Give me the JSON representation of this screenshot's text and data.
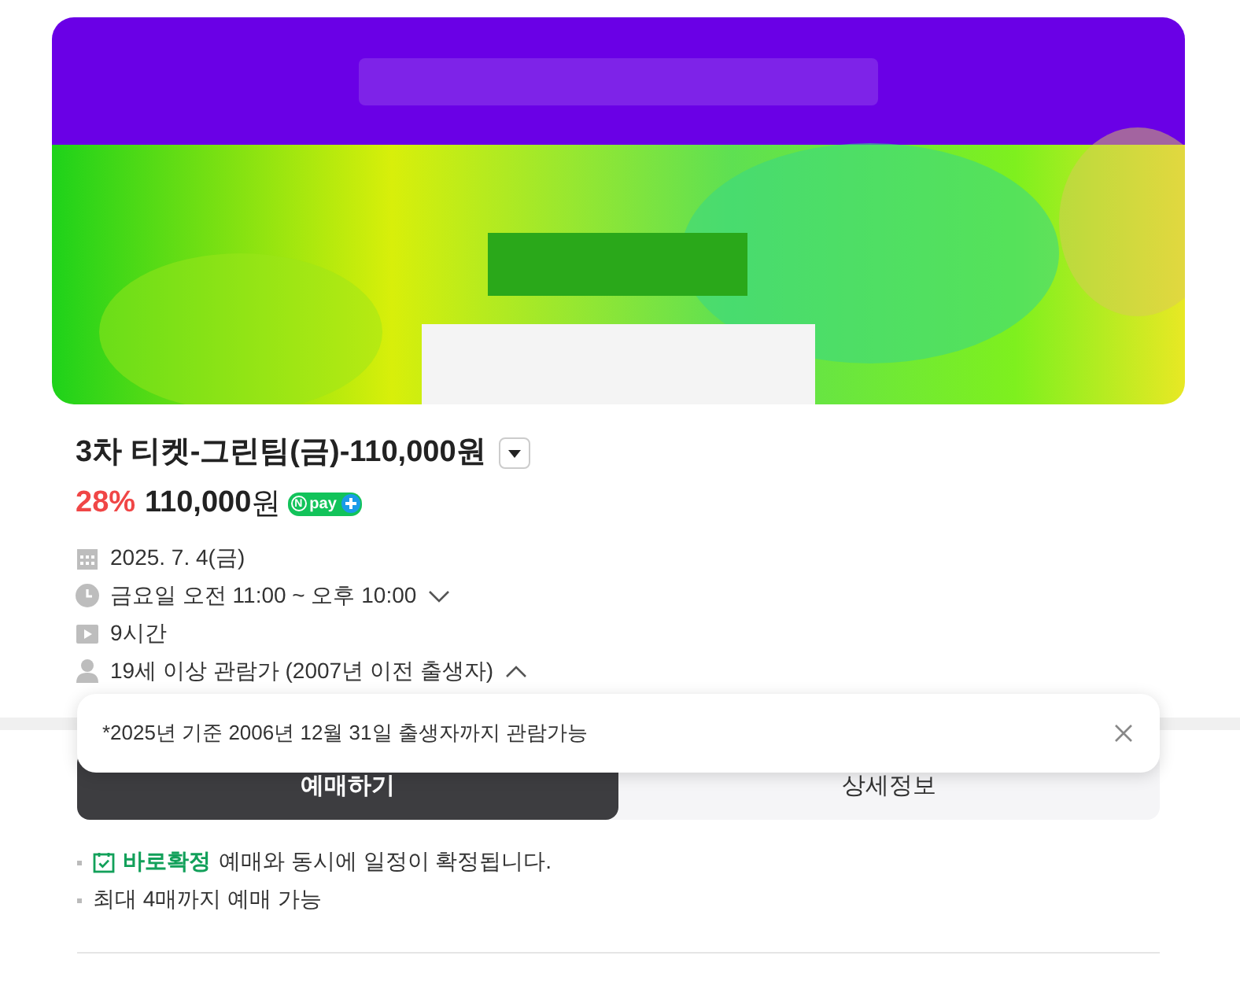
{
  "product": {
    "title": "3차 티켓-그린팀(금)-110,000원",
    "discount": "28%",
    "price": "110,000",
    "currency": "원",
    "pay_badge": {
      "mark": "N",
      "label": "pay"
    }
  },
  "info": [
    {
      "kind": "date",
      "text": "2025. 7. 4(금)"
    },
    {
      "kind": "time",
      "text": "금요일 오전 11:00 ~ 오후 10:00",
      "expanded": false
    },
    {
      "kind": "duration",
      "text": "9시간"
    },
    {
      "kind": "age",
      "text": "19세 이상 관람가 (2007년 이전 출생자)",
      "expanded": true
    }
  ],
  "tooltip": {
    "text": "*2025년 기준 2006년 12월 31일 출생자까지 관람가능"
  },
  "tabs": [
    {
      "label": "예매하기",
      "selected": true
    },
    {
      "label": "상세정보",
      "selected": false
    }
  ],
  "notes": [
    {
      "kind": "confirm",
      "highlight": "바로확정",
      "text": "예매와 동시에 일정이 확정됩니다."
    },
    {
      "kind": "plain",
      "text": "최대 4매까지 예매 가능"
    }
  ]
}
